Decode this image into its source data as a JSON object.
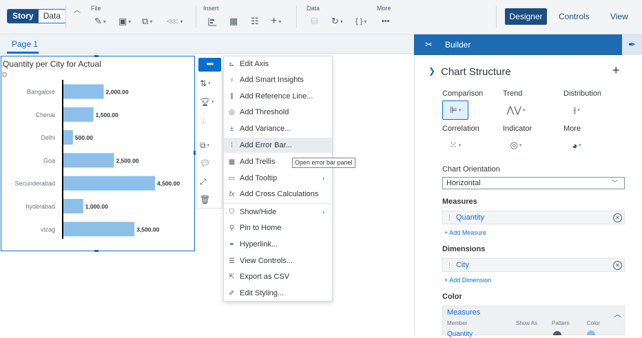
{
  "toolbar": {
    "tab_story": "Story",
    "tab_data": "Data",
    "group_file": "File",
    "group_insert": "Insert",
    "group_data": "Data",
    "group_more": "More",
    "designer": "Designer",
    "controls": "Controls",
    "view": "View"
  },
  "page": {
    "tab_label": "Page 1"
  },
  "widget": {
    "more_label": "•••"
  },
  "menu": {
    "items": [
      {
        "icon": "edit-axis-icon",
        "label": "Edit Axis"
      },
      {
        "icon": "lightbulb-icon",
        "label": "Add Smart Insights"
      },
      {
        "icon": "reference-line-icon",
        "label": "Add Reference Line..."
      },
      {
        "icon": "threshold-icon",
        "label": "Add Threshold"
      },
      {
        "icon": "variance-icon",
        "label": "Add Variance..."
      },
      {
        "icon": "error-bar-icon",
        "label": "Add Error Bar..."
      },
      {
        "icon": "trellis-icon",
        "label": "Add Trellis"
      },
      {
        "icon": "tooltip-icon",
        "label": "Add Tooltip"
      },
      {
        "icon": "fx-icon",
        "label": "Add Cross Calculations"
      },
      {
        "icon": "show-hide-icon",
        "label": "Show/Hide"
      },
      {
        "icon": "pin-icon",
        "label": "Pin to Home"
      },
      {
        "icon": "hyperlink-icon",
        "label": "Hyperlink..."
      },
      {
        "icon": "view-controls-icon",
        "label": "View Controls..."
      },
      {
        "icon": "export-icon",
        "label": "Export as CSV"
      },
      {
        "icon": "brush-icon",
        "label": "Edit Styling..."
      }
    ],
    "tooltip": "Open error bar panel"
  },
  "builder": {
    "title": "Builder",
    "section_title": "Chart Structure",
    "categories": {
      "comparison": "Comparison",
      "trend": "Trend",
      "distribution": "Distribution",
      "correlation": "Correlation",
      "indicator": "Indicator",
      "more": "More"
    },
    "orientation_label": "Chart Orientation",
    "orientation_value": "Horizontal",
    "measures_label": "Measures",
    "measure_token": "Quantity",
    "add_measure": "+ Add Measure",
    "dimensions_label": "Dimensions",
    "dimension_token": "City",
    "add_dimension": "+ Add Dimension",
    "color_label": "Color",
    "color_measures": "Measures",
    "color_cols": {
      "member": "Member",
      "show_as": "Show As",
      "pattern": "Pattern",
      "color": "Color"
    },
    "color_row1": "Quantity"
  },
  "colors": {
    "bar": "#8cc0ea",
    "accent": "#0a6ed1",
    "shell": "#1c4e80",
    "builder_header": "#1c6bb3"
  },
  "chart_data": {
    "type": "bar",
    "orientation": "horizontal",
    "title": "Quantity per City for Actual",
    "categories": [
      "Bangalore",
      "Chenai",
      "Delhi",
      "Goa",
      "Secunderabad",
      "hyderabad",
      "vizag"
    ],
    "values": [
      2000,
      1500,
      500,
      2500,
      4500,
      1000,
      3500
    ],
    "value_labels": [
      "2,000.00",
      "1,500.00",
      "500.00",
      "2,500.00",
      "4,500.00",
      "1,000.00",
      "3,500.00"
    ],
    "grid": false
  }
}
